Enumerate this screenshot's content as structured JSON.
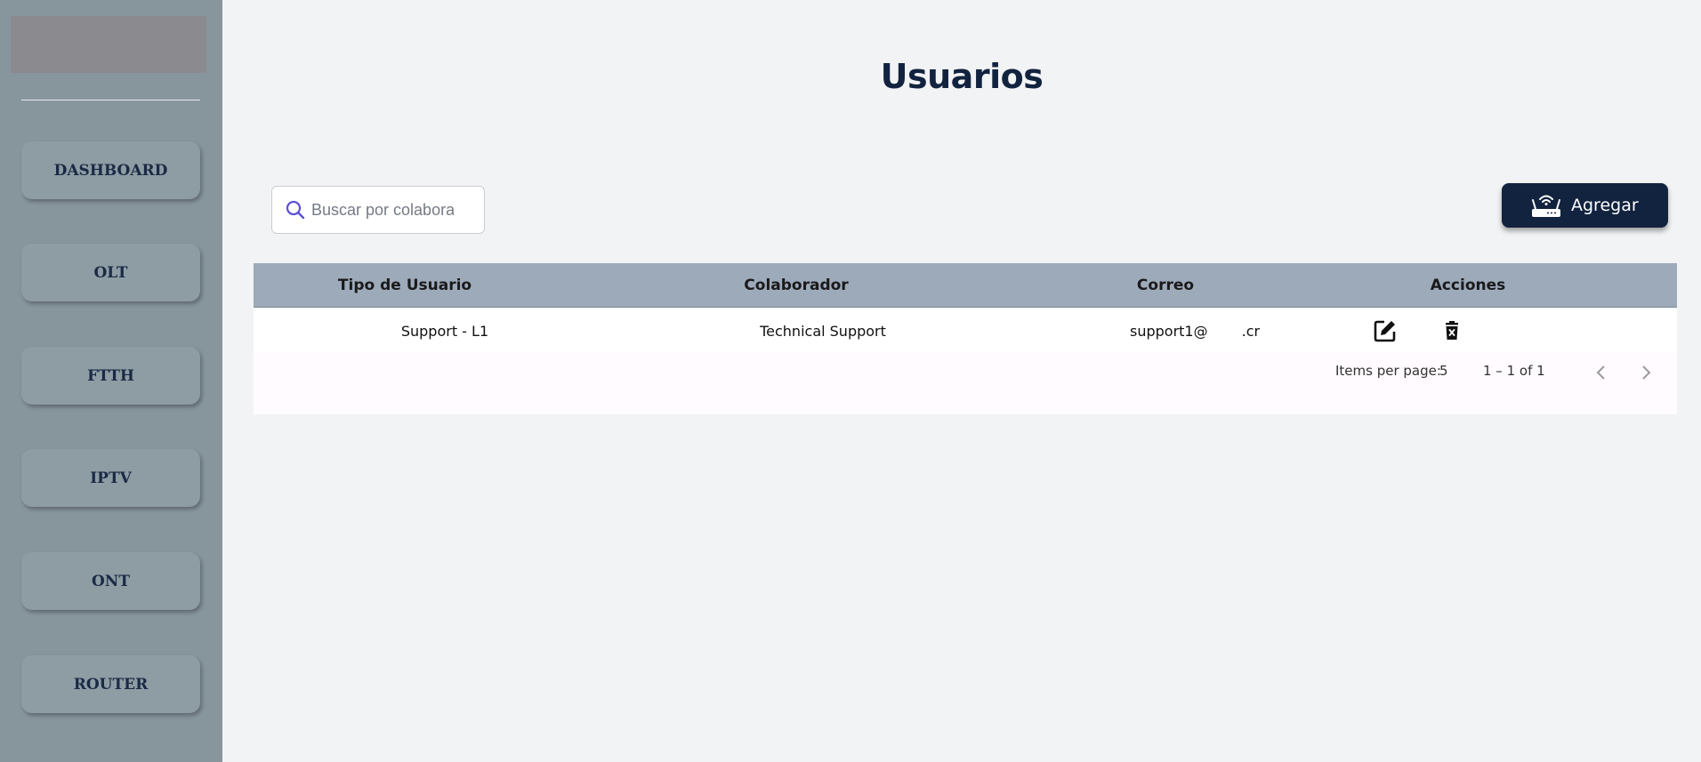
{
  "sidebar": {
    "items": [
      {
        "label": "DASHBOARD"
      },
      {
        "label": "OLT"
      },
      {
        "label": "FTTH"
      },
      {
        "label": "IPTV"
      },
      {
        "label": "ONT"
      },
      {
        "label": "ROUTER"
      }
    ]
  },
  "page": {
    "title": "Usuarios"
  },
  "search": {
    "placeholder": "Buscar por colaborador"
  },
  "add_button": {
    "label": "Agregar"
  },
  "table": {
    "columns": [
      "Tipo de Usuario",
      "Colaborador",
      "Correo",
      "Acciones"
    ],
    "rows": [
      {
        "tipo": "Support - L1",
        "colaborador": "Technical Support",
        "correo_start": "support1@",
        "correo_end": ".cr"
      }
    ]
  },
  "paginator": {
    "items_per_page_label": "Items per page:",
    "items_per_page_value": "5",
    "range": "1 – 1 of 1"
  },
  "colors": {
    "sidebar_bg": "#87959d",
    "primary_dark": "#12233f",
    "table_header_bg": "#9daaba",
    "search_icon": "#5b4fd6"
  },
  "icons": [
    "router-icon",
    "search-icon",
    "edit-icon",
    "delete-icon",
    "chevron-left-icon",
    "chevron-right-icon"
  ]
}
